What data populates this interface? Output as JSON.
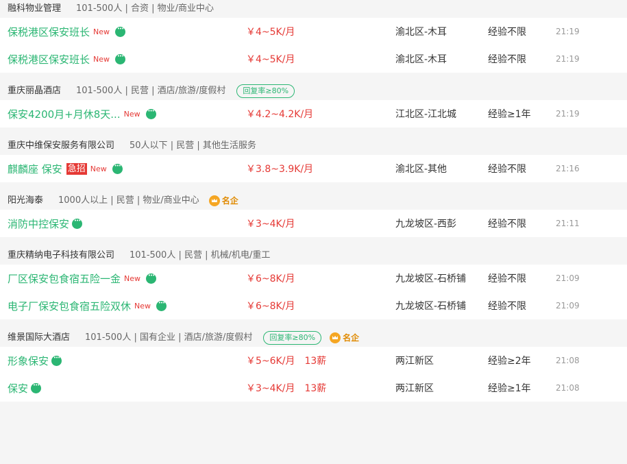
{
  "accent": "#2bb673",
  "salary_color": "#e53935",
  "groups": [
    {
      "company": "融科物业管理",
      "info": "101-500人 | 合资 | 物业/商业中心",
      "rows": [
        {
          "title": "保税港区保安班长",
          "new": "New",
          "salary": "￥4~5K/月",
          "location": "渝北区-木耳",
          "exp": "经验不限",
          "time": "21:19"
        },
        {
          "title": "保税港区保安班长",
          "new": "New",
          "salary": "￥4~5K/月",
          "location": "渝北区-木耳",
          "exp": "经验不限",
          "time": "21:19"
        }
      ]
    },
    {
      "company": "重庆丽晶酒店",
      "info": "101-500人 | 民营 | 酒店/旅游/度假村",
      "rate": "回复率≥80%",
      "rows": [
        {
          "title": "保安4200月+月休8天...",
          "new": "New",
          "salary": "￥4.2~4.2K/月",
          "location": "江北区-江北城",
          "exp": "经验≥1年",
          "time": "21:19"
        }
      ]
    },
    {
      "company": "重庆中维保安服务有限公司",
      "info": "50人以下 | 民营 | 其他生活服务",
      "rows": [
        {
          "title": "麒麟座 保安",
          "urgent": "急招",
          "new": "New",
          "salary": "￥3.8~3.9K/月",
          "location": "渝北区-其他",
          "exp": "经验不限",
          "time": "21:16"
        }
      ]
    },
    {
      "company": "阳光海泰",
      "info": "1000人以上 | 民营 | 物业/商业中心",
      "vip": "名企",
      "rows": [
        {
          "title": "消防中控保安",
          "salary": "￥3~4K/月",
          "location": "九龙坡区-西彭",
          "exp": "经验不限",
          "time": "21:11"
        }
      ]
    },
    {
      "company": "重庆精纳电子科技有限公司",
      "info": "101-500人 | 民营 | 机械/机电/重工",
      "rows": [
        {
          "title": "厂区保安包食宿五险一金",
          "new": "New",
          "salary": "￥6~8K/月",
          "location": "九龙坡区-石桥铺",
          "exp": "经验不限",
          "time": "21:09"
        },
        {
          "title": "电子厂保安包食宿五险双休",
          "new": "New",
          "salary": "￥6~8K/月",
          "location": "九龙坡区-石桥铺",
          "exp": "经验不限",
          "time": "21:09"
        }
      ]
    },
    {
      "company": "维景国际大酒店",
      "info": "101-500人 | 国有企业 | 酒店/旅游/度假村",
      "rate": "回复率≥80%",
      "vip": "名企",
      "rows": [
        {
          "title": "形象保安",
          "salary": "￥5~6K/月",
          "months": "13薪",
          "location": "两江新区",
          "exp": "经验≥2年",
          "time": "21:08"
        },
        {
          "title": "保安",
          "salary": "￥3~4K/月",
          "months": "13薪",
          "location": "两江新区",
          "exp": "经验≥1年",
          "time": "21:08"
        }
      ]
    }
  ]
}
